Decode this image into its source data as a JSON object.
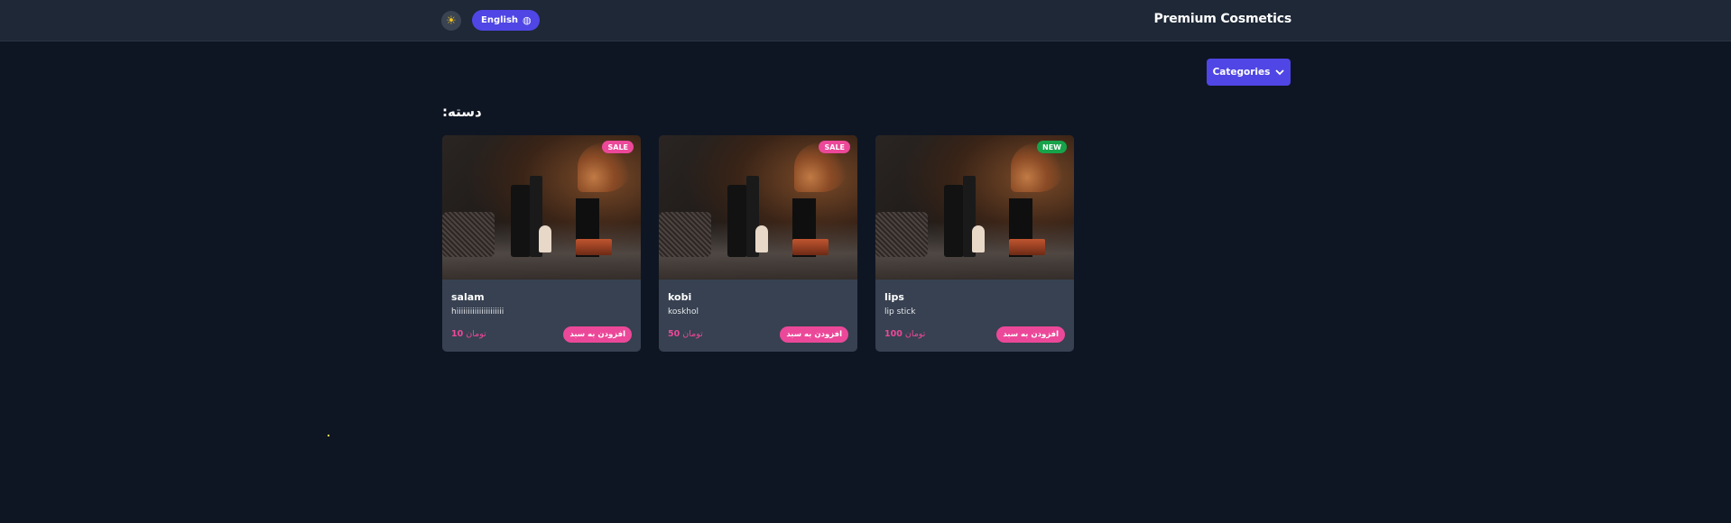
{
  "header": {
    "theme_icon": "sun-icon",
    "language_label": "English",
    "language_icon": "globe-icon",
    "brand": "Premium Cosmetics"
  },
  "categories_button": {
    "label": "Categories",
    "icon": "chevron-down-icon"
  },
  "section_title": "دسته:",
  "products": [
    {
      "name": "salam",
      "description": "hiiiiiiiiiiiiiiiiiiiii",
      "price": "10",
      "currency": "تومان",
      "badge": "SALE",
      "add_label": "افزودن به سبد"
    },
    {
      "name": "kobi",
      "description": "koskhol",
      "price": "50",
      "currency": "تومان",
      "badge": "SALE",
      "add_label": "افزودن به سبد"
    },
    {
      "name": "lips",
      "description": "lip stick",
      "price": "100",
      "currency": "تومان",
      "badge": "NEW",
      "add_label": "افزودن به سبد"
    }
  ],
  "colors": {
    "background": "#0f1623",
    "header": "#1e2836",
    "card": "#374151",
    "accent": "#4f46e5",
    "pink": "#ec4899",
    "new_badge": "#16a34a"
  }
}
